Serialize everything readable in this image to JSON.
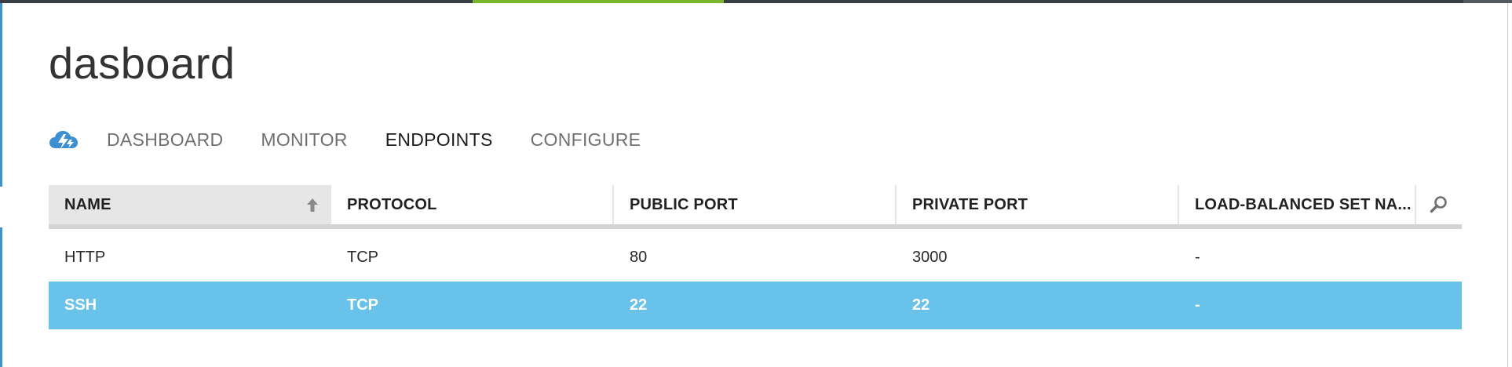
{
  "colors": {
    "accent_green": "#7ab52d",
    "selected_row": "#68c2e9",
    "edge_blue": "#3b95c8"
  },
  "page": {
    "title": "dasboard"
  },
  "nav": {
    "logo_icon": "cloud-service-icon",
    "tabs": [
      {
        "label": "DASHBOARD",
        "active": false
      },
      {
        "label": "MONITOR",
        "active": false
      },
      {
        "label": "ENDPOINTS",
        "active": true
      },
      {
        "label": "CONFIGURE",
        "active": false
      }
    ]
  },
  "table": {
    "columns": [
      "NAME",
      "PROTOCOL",
      "PUBLIC PORT",
      "PRIVATE PORT",
      "LOAD-BALANCED SET NA..."
    ],
    "sorted_column": "NAME",
    "sort_direction": "ascending",
    "search_icon": "search-icon",
    "rows": [
      {
        "name": "HTTP",
        "protocol": "TCP",
        "public_port": "80",
        "private_port": "3000",
        "load_balanced_set": "-",
        "selected": false
      },
      {
        "name": "SSH",
        "protocol": "TCP",
        "public_port": "22",
        "private_port": "22",
        "load_balanced_set": "-",
        "selected": true
      }
    ]
  }
}
